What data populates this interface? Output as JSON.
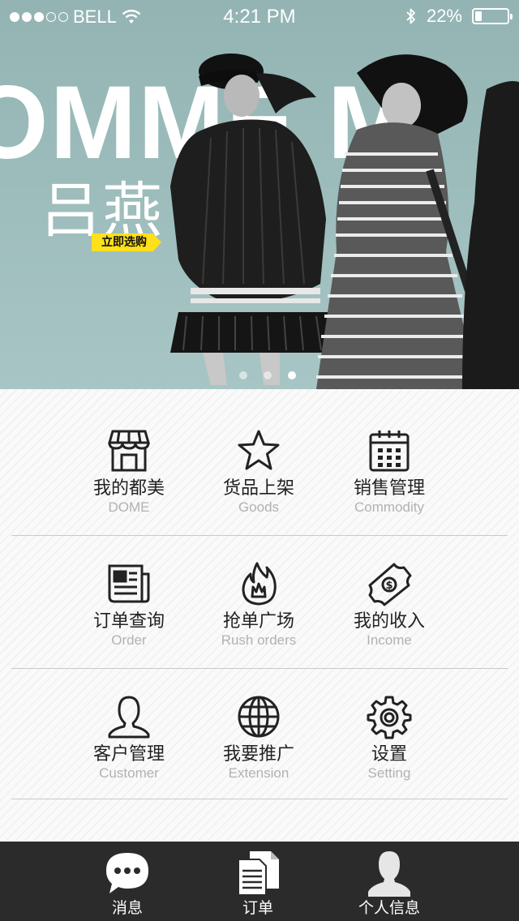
{
  "status_bar": {
    "carrier": "BELL",
    "time": "4:21 PM",
    "battery": "22%",
    "battery_level": 0.22
  },
  "banner": {
    "brand_text": "OMME M",
    "title": "吕燕",
    "cta_label": "立即选购",
    "slides": 3,
    "active_slide": 3
  },
  "menu": {
    "rows": [
      [
        {
          "cn": "我的都美",
          "en": "DOME",
          "icon": "store-icon"
        },
        {
          "cn": "货品上架",
          "en": "Goods",
          "icon": "star-icon"
        },
        {
          "cn": "销售管理",
          "en": "Commodity",
          "icon": "calendar-icon"
        }
      ],
      [
        {
          "cn": "订单查询",
          "en": "Order",
          "icon": "newspaper-icon"
        },
        {
          "cn": "抢单广场",
          "en": "Rush orders",
          "icon": "flame-icon"
        },
        {
          "cn": "我的收入",
          "en": "Income",
          "icon": "money-icon"
        }
      ],
      [
        {
          "cn": "客户管理",
          "en": "Customer",
          "icon": "person-icon"
        },
        {
          "cn": "我要推广",
          "en": "Extension",
          "icon": "globe-icon"
        },
        {
          "cn": "设置",
          "en": "Setting",
          "icon": "gear-icon"
        }
      ]
    ]
  },
  "tabbar": {
    "items": [
      {
        "label": "消息",
        "icon": "chat-bubble-icon"
      },
      {
        "label": "订单",
        "icon": "documents-icon"
      },
      {
        "label": "个人信息",
        "icon": "user-icon"
      }
    ]
  },
  "colors": {
    "banner_bg": "#9cbcbb",
    "cta_bg": "#ffe01a",
    "tabbar_bg": "#2b2b2b",
    "label_en": "#b2b2b2"
  }
}
